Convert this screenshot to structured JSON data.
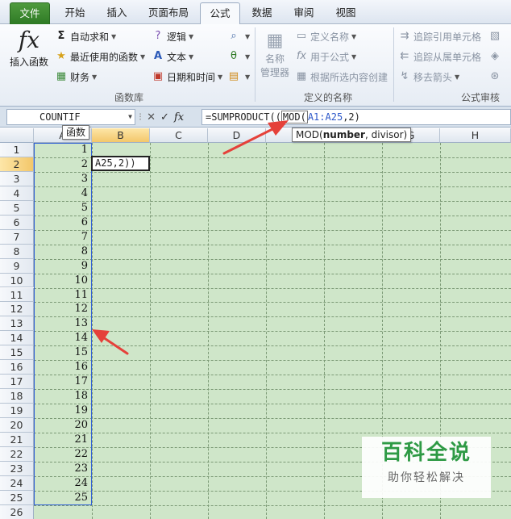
{
  "tabs": [
    "文件",
    "开始",
    "插入",
    "页面布局",
    "公式",
    "数据",
    "审阅",
    "视图"
  ],
  "ribbon": {
    "insert_function": "插入函数",
    "autosum": "自动求和",
    "recent": "最近使用的函数",
    "financial": "财务",
    "logical": "逻辑",
    "text": "文本",
    "datetime": "日期和时间",
    "library_label": "函数库",
    "name_manager_1": "名称",
    "name_manager_2": "管理器",
    "define_name": "定义名称",
    "use_in_formula": "用于公式",
    "create_from_sel": "根据所选内容创建",
    "names_label": "定义的名称",
    "trace_precedents": "追踪引用单元格",
    "trace_dependents": "追踪从属单元格",
    "remove_arrows": "移去箭头",
    "audit_label": "公式审核"
  },
  "formula_bar": {
    "name_box": "COUNTIF",
    "fx": "fx",
    "formula_pre": "=SUMPRODUCT((",
    "formula_mod": "MOD(",
    "formula_ref": "A1:A25",
    "formula_post": ",2)"
  },
  "tooltips": {
    "function_tip": "函数",
    "syntax_pre": "MOD(",
    "syntax_bold": "number",
    "syntax_post": ", divisor)"
  },
  "columns": [
    "A",
    "B",
    "C",
    "D",
    "E",
    "F",
    "G",
    "H"
  ],
  "rows": [
    "1",
    "2",
    "3",
    "4",
    "5",
    "6",
    "7",
    "8",
    "9",
    "10",
    "11",
    "12",
    "13",
    "14",
    "15",
    "16",
    "17",
    "18",
    "19",
    "20",
    "21",
    "22",
    "23",
    "24",
    "25",
    "26"
  ],
  "cell_values_A": [
    "1",
    "2",
    "3",
    "4",
    "5",
    "6",
    "7",
    "8",
    "9",
    "10",
    "11",
    "12",
    "13",
    "14",
    "15",
    "16",
    "17",
    "18",
    "19",
    "20",
    "21",
    "22",
    "23",
    "24",
    "25"
  ],
  "active_cell": {
    "text": "A25,2))"
  },
  "watermark": {
    "title": "百科全说",
    "subtitle": "助你轻松解决"
  },
  "colors": {
    "sheet_bg": "#cfe6c9",
    "file_tab": "#2e7a25",
    "selection": "#2f5fd6",
    "arrow": "#e5413a"
  }
}
